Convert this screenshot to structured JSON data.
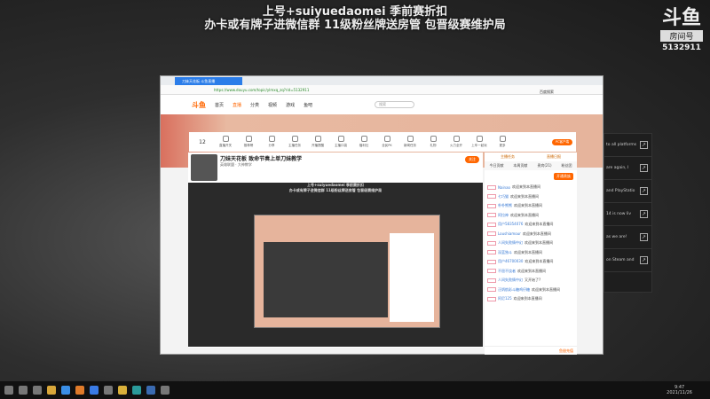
{
  "overlay": {
    "line1": "上号+suiyuedaomei 季前赛折扣",
    "line2": "办卡或有牌子进微信群 11级粉丝牌送房管  包晋级赛维护局"
  },
  "logo": {
    "brand": "斗鱼",
    "label": "房间号",
    "room_id": "5132911"
  },
  "browser": {
    "tab_title": "刀妹天花板 斗鱼直播",
    "url": "https://www.douyu.com/topic/ylmxq_zq?rid=5132911",
    "search_label": "百度搜索"
  },
  "douyu_nav": {
    "brand": "斗鱼",
    "items": [
      "首页",
      "直播",
      "分类",
      "视频",
      "游戏",
      "鱼吧"
    ],
    "search_placeholder": "搜索"
  },
  "toolbar": {
    "count": "12",
    "items": [
      "主播等级",
      "直播开关",
      "推荐榜",
      "分享",
      "主播任务",
      "开播提醒",
      "主播口袋",
      "福利社",
      "全民PK",
      "新闻任务",
      "礼物",
      "火力全开",
      "上车一起玩",
      "更多"
    ],
    "pc_button": "PC客户端"
  },
  "stream": {
    "title": "刀妹天花板 致命节奏上单刀妹教学",
    "meta": "英雄联盟 · 大神教学",
    "follow": "关注",
    "video_line1": "上号+suiyuedaomei 季前赛折扣",
    "video_line2": "办卡或有牌子进微信群 11级粉丝牌送房管 包晋级赛维护局"
  },
  "chat": {
    "header": [
      "主播任务",
      "直播日报"
    ],
    "tabs": [
      "今日贡献",
      "本周贡献",
      "贵宾(21)",
      "粉丝团"
    ],
    "join_button": "开通贵族",
    "messages": [
      {
        "name": "Nainao",
        "text": "欢迎来到本直播间"
      },
      {
        "name": "七巧猫",
        "text": "欢迎来到本直播间"
      },
      {
        "name": "朴朴熊熊",
        "text": "欢迎来到本直播间"
      },
      {
        "name": "阿拉神",
        "text": "欢迎来到本直播间"
      },
      {
        "name": "用户58354076",
        "text": "欢迎来到本直播间"
      },
      {
        "name": "Loushiamour",
        "text": "欢迎来到本直播间"
      },
      {
        "name": "人间失败情中幻",
        "text": "欢迎来到本直播间"
      },
      {
        "name": "深蓝独斗",
        "text": "欢迎来到本直播间"
      },
      {
        "name": "用户46700030",
        "text": "欢迎来到本直播间"
      },
      {
        "name": "不屈不饶者",
        "text": "欢迎来到本直播间"
      },
      {
        "name": "人间失败情中幻",
        "text": "又开始了?"
      },
      {
        "name": "汪炳航彩斗糖鸡仔糖",
        "text": "欢迎来到本直播间"
      },
      {
        "name": "阿尼125",
        "text": "欢迎来到本直播间"
      }
    ],
    "footer": "鱼翅充值"
  },
  "side_panel": [
    "to all platforms",
    "are again, I",
    "and PlayStatio",
    "14 is now liv",
    "as we are!",
    "on Steam and"
  ],
  "taskbar": {
    "time": "9:47",
    "date": "2021/11/26"
  }
}
